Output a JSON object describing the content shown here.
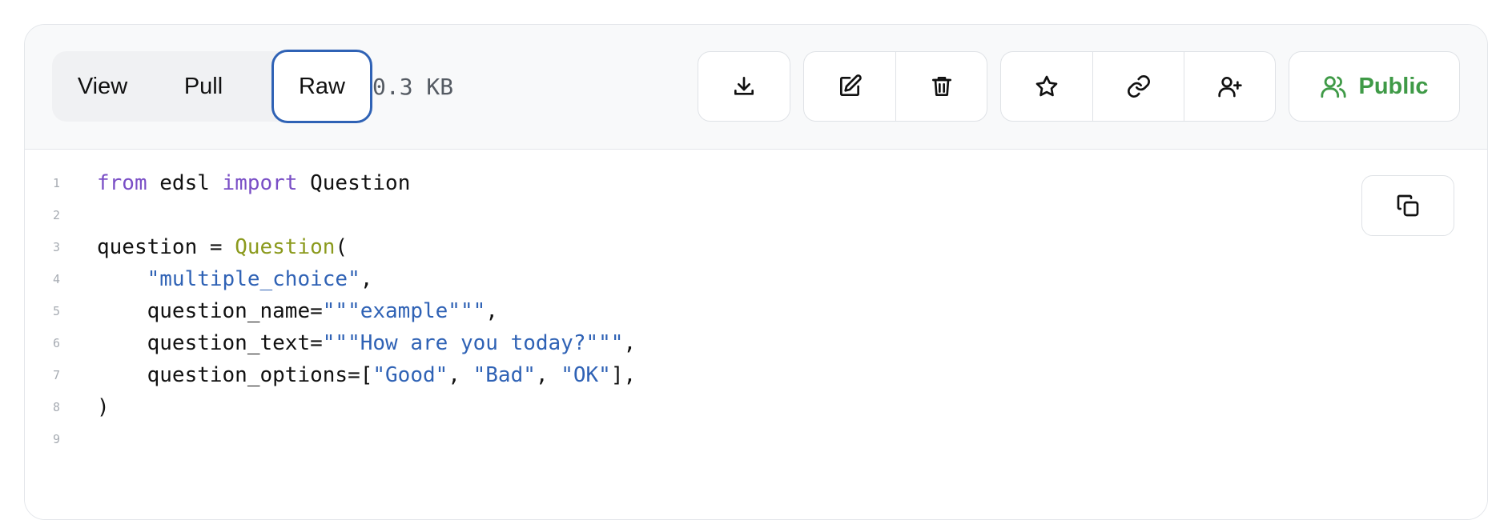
{
  "tabs": {
    "view": "View",
    "pull": "Pull",
    "raw": "Raw",
    "active": "Raw"
  },
  "file_size": "0.3 KB",
  "actions": {
    "download_icon": "download-icon",
    "edit_icon": "edit-icon",
    "delete_icon": "trash-icon",
    "star_icon": "star-icon",
    "link_icon": "link-icon",
    "share_icon": "add-user-icon",
    "visibility_label": "Public",
    "visibility_icon": "users-icon"
  },
  "colors": {
    "accent_blue": "#2f62b5",
    "public_green": "#3f9a47",
    "keyword_purple": "#7a4fc6",
    "function_olive": "#8b9a1d",
    "string_blue": "#2f62b5"
  },
  "code": {
    "language": "python",
    "copy_icon": "copy-icon",
    "lines": [
      {
        "n": "1",
        "tokens": [
          {
            "t": "from",
            "c": "kw"
          },
          {
            "t": " edsl ",
            "c": ""
          },
          {
            "t": "import",
            "c": "kw"
          },
          {
            "t": " Question",
            "c": ""
          }
        ]
      },
      {
        "n": "2",
        "tokens": []
      },
      {
        "n": "3",
        "tokens": [
          {
            "t": "question = ",
            "c": ""
          },
          {
            "t": "Question",
            "c": "fn"
          },
          {
            "t": "(",
            "c": ""
          }
        ]
      },
      {
        "n": "4",
        "tokens": [
          {
            "t": "    ",
            "c": ""
          },
          {
            "t": "\"multiple_choice\"",
            "c": "str"
          },
          {
            "t": ",",
            "c": ""
          }
        ]
      },
      {
        "n": "5",
        "tokens": [
          {
            "t": "    question_name=",
            "c": ""
          },
          {
            "t": "\"\"\"example\"\"\"",
            "c": "str"
          },
          {
            "t": ",",
            "c": ""
          }
        ]
      },
      {
        "n": "6",
        "tokens": [
          {
            "t": "    question_text=",
            "c": ""
          },
          {
            "t": "\"\"\"How are you today?\"\"\"",
            "c": "str"
          },
          {
            "t": ",",
            "c": ""
          }
        ]
      },
      {
        "n": "7",
        "tokens": [
          {
            "t": "    question_options=[",
            "c": ""
          },
          {
            "t": "\"Good\"",
            "c": "str"
          },
          {
            "t": ", ",
            "c": ""
          },
          {
            "t": "\"Bad\"",
            "c": "str"
          },
          {
            "t": ", ",
            "c": ""
          },
          {
            "t": "\"OK\"",
            "c": "str"
          },
          {
            "t": "],",
            "c": ""
          }
        ]
      },
      {
        "n": "8",
        "tokens": [
          {
            "t": ")",
            "c": ""
          }
        ]
      },
      {
        "n": "9",
        "tokens": []
      }
    ]
  }
}
